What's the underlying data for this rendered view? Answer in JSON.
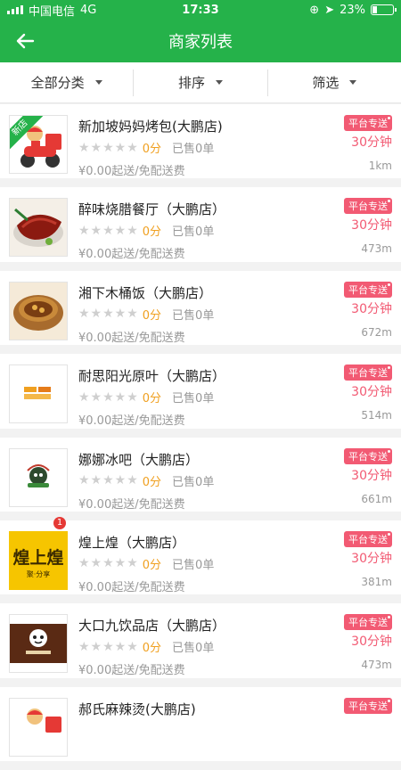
{
  "status": {
    "carrier": "中国电信",
    "network": "4G",
    "time": "17:33",
    "battery": "23%",
    "battery_level": 0.23
  },
  "nav": {
    "title": "商家列表"
  },
  "filters": [
    {
      "label": "全部分类"
    },
    {
      "label": "排序"
    },
    {
      "label": "筛选"
    }
  ],
  "shops": [
    {
      "name": "新加坡妈妈烤包(大鹏店)",
      "score": "0分",
      "sold": "已售0单",
      "fee": "¥0.00起送/免配送费",
      "badge": "平台专送",
      "time": "30分钟",
      "distance": "1km",
      "ribbon": "新店"
    },
    {
      "name": "醉味烧腊餐厅（大鹏店）",
      "score": "0分",
      "sold": "已售0单",
      "fee": "¥0.00起送/免配送费",
      "badge": "平台专送",
      "time": "30分钟",
      "distance": "473m"
    },
    {
      "name": "湘下木桶饭（大鹏店）",
      "score": "0分",
      "sold": "已售0单",
      "fee": "¥0.00起送/免配送费",
      "badge": "平台专送",
      "time": "30分钟",
      "distance": "672m"
    },
    {
      "name": "耐思阳光原叶（大鹏店）",
      "score": "0分",
      "sold": "已售0单",
      "fee": "¥0.00起送/免配送费",
      "badge": "平台专送",
      "time": "30分钟",
      "distance": "514m"
    },
    {
      "name": "娜娜冰吧（大鹏店）",
      "score": "0分",
      "sold": "已售0单",
      "fee": "¥0.00起送/免配送费",
      "badge": "平台专送",
      "time": "30分钟",
      "distance": "661m"
    },
    {
      "name": "煌上煌（大鹏店）",
      "score": "0分",
      "sold": "已售0单",
      "fee": "¥0.00起送/免配送费",
      "badge": "平台专送",
      "time": "30分钟",
      "distance": "381m",
      "count": "1",
      "logo_text": "煌上煌",
      "logo_sub": "聚·分享"
    },
    {
      "name": "大口九饮品店（大鹏店）",
      "score": "0分",
      "sold": "已售0单",
      "fee": "¥0.00起送/免配送费",
      "badge": "平台专送",
      "time": "30分钟",
      "distance": "473m"
    },
    {
      "name": "郝氏麻辣烫(大鹏店)",
      "score": "",
      "sold": "",
      "fee": "",
      "badge": "平台专送",
      "time": "",
      "distance": ""
    }
  ],
  "stars": "★★★★★",
  "colors": {
    "brand": "#25b24a",
    "accent": "#f25a73",
    "score": "#f0a020"
  }
}
